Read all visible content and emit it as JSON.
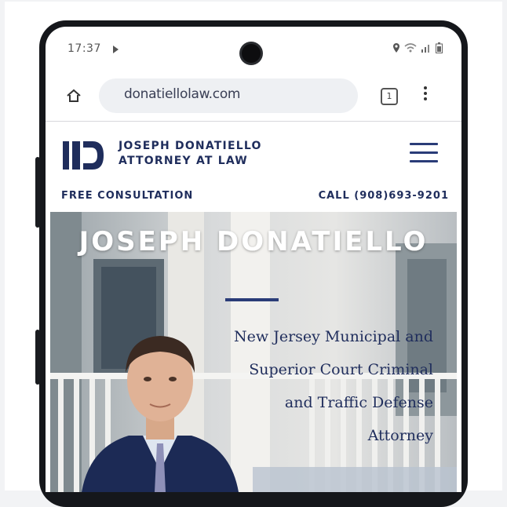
{
  "status_bar": {
    "time": "17:37",
    "icons": [
      "play-icon",
      "location-icon",
      "wifi-icon",
      "signal-icon",
      "battery-icon"
    ]
  },
  "browser": {
    "url": "donatiellolaw.com",
    "tab_count": "1"
  },
  "site": {
    "firm_line1": "JOSEPH DONATIELLO",
    "firm_line2": "ATTORNEY AT LAW",
    "logo_letters": "JD",
    "cta_left": "FREE CONSULTATION",
    "cta_right": "CALL (908)693-9201"
  },
  "hero": {
    "title": "JOSEPH DONATIELLO",
    "subtitle_lines": [
      "New Jersey Municipal and",
      "Superior Court Criminal",
      "and Traffic Defense",
      "Attorney"
    ]
  },
  "colors": {
    "brand_navy": "#1f2d5c",
    "accent_blue": "#2a3c78"
  }
}
